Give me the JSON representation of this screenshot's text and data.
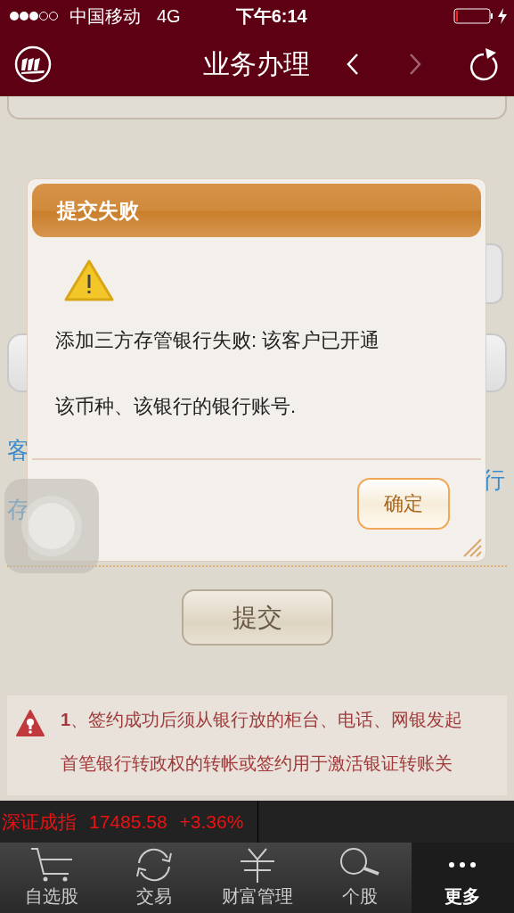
{
  "status_bar": {
    "carrier": "中国移动",
    "network": "4G",
    "time": "下午6:14"
  },
  "nav": {
    "title": "业务办理",
    "back": {
      "disabled": false
    },
    "forward": {
      "disabled": true
    }
  },
  "form": {
    "blue_rows": [
      {
        "left": "客"
      },
      {
        "right": "行"
      },
      {
        "left": "存"
      }
    ],
    "submit_button": "提交"
  },
  "notice": {
    "lines": [
      "**1**、签约成功后须从银行放的柜台、电话、网银发起",
      "首笔银行转政权的转帐或签约用于激活银证转账关"
    ]
  },
  "ticker": {
    "name": "深证成指",
    "value": "17485.58",
    "change": "+3.36%"
  },
  "tabs": [
    {
      "kind": "cart",
      "label": "自选股",
      "selected": false
    },
    {
      "kind": "cycle",
      "label": "交易",
      "selected": false
    },
    {
      "kind": "yen",
      "label": "财富管理",
      "selected": false
    },
    {
      "kind": "search",
      "label": "个股",
      "selected": false
    },
    {
      "kind": "more",
      "label": "更多",
      "selected": true
    }
  ],
  "dialog": {
    "title": "提交失败",
    "message_lines": [
      "添加三方存管银行失败:  该客户已开通",
      "该币种、该银行的银行账号."
    ],
    "button": "确定"
  }
}
